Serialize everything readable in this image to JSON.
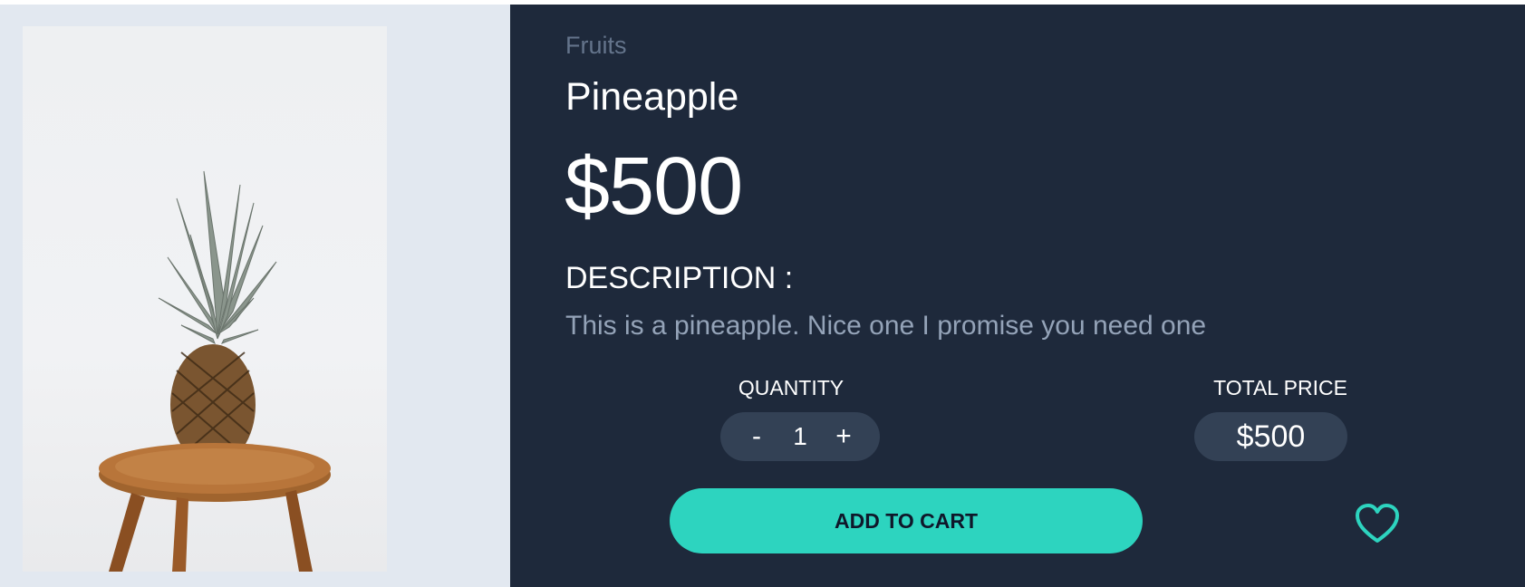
{
  "product": {
    "category": "Fruits",
    "name": "Pineapple",
    "price": "$500",
    "description_heading": "DESCRIPTION :",
    "description": "This is a pineapple. Nice one I promise you need one"
  },
  "quantity": {
    "label": "QUANTITY",
    "decrement": "-",
    "value": "1",
    "increment": "+"
  },
  "total": {
    "label": "TOTAL PRICE",
    "value": "$500"
  },
  "actions": {
    "add_to_cart": "ADD TO CART",
    "favorite_icon": "heart-icon"
  },
  "colors": {
    "info_background": "#1e293b",
    "pill_background": "#334155",
    "accent": "#2dd4bf",
    "image_panel_background": "#e2e8f0"
  }
}
